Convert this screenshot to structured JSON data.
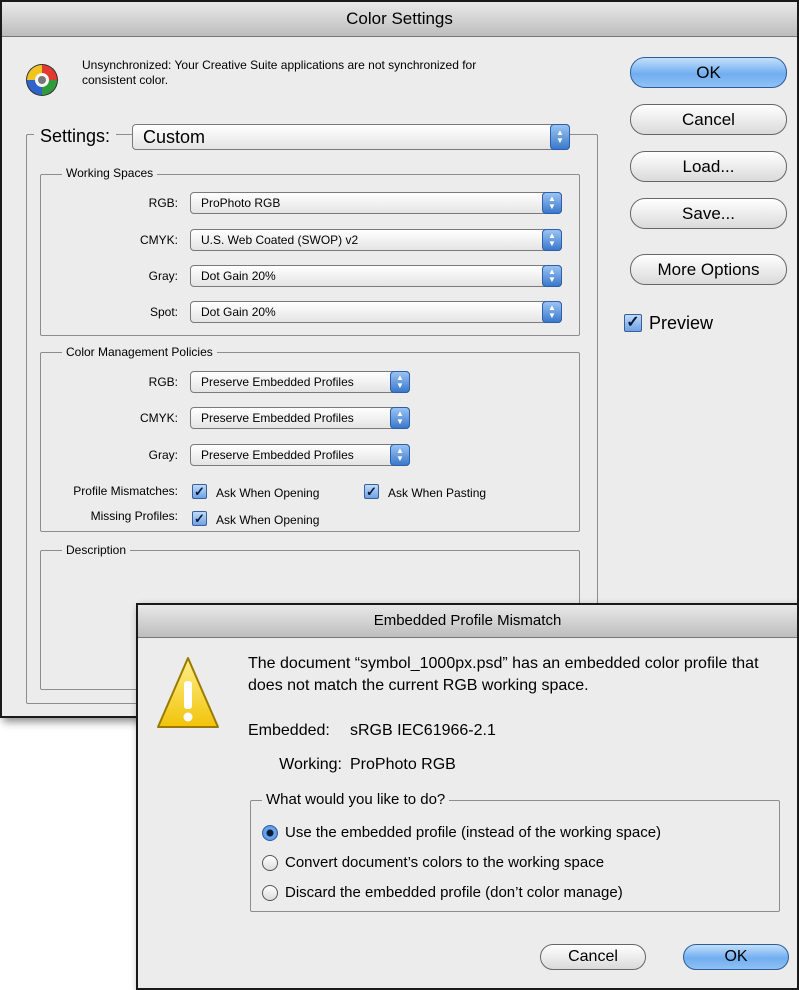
{
  "color_settings": {
    "title": "Color Settings",
    "sync_message": "Unsynchronized: Your Creative Suite applications are not synchronized for consistent color.",
    "settings_label": "Settings:",
    "settings_value": "Custom",
    "working_spaces": {
      "legend": "Working Spaces",
      "rgb_label": "RGB:",
      "rgb_value": "ProPhoto RGB",
      "cmyk_label": "CMYK:",
      "cmyk_value": "U.S. Web Coated (SWOP) v2",
      "gray_label": "Gray:",
      "gray_value": "Dot Gain 20%",
      "spot_label": "Spot:",
      "spot_value": "Dot Gain 20%"
    },
    "policies": {
      "legend": "Color Management Policies",
      "rgb_label": "RGB:",
      "rgb_value": "Preserve Embedded Profiles",
      "cmyk_label": "CMYK:",
      "cmyk_value": "Preserve Embedded Profiles",
      "gray_label": "Gray:",
      "gray_value": "Preserve Embedded Profiles",
      "profile_mismatches_label": "Profile Mismatches:",
      "ask_when_opening": "Ask When Opening",
      "ask_when_pasting": "Ask When Pasting",
      "missing_profiles_label": "Missing Profiles:",
      "missing_ask_when_opening": "Ask When Opening"
    },
    "description_legend": "Description",
    "buttons": {
      "ok": "OK",
      "cancel": "Cancel",
      "load": "Load...",
      "save": "Save...",
      "more_options": "More Options"
    },
    "preview_label": "Preview"
  },
  "mismatch_dialog": {
    "title": "Embedded Profile Mismatch",
    "message": "The document “symbol_1000px.psd” has an embedded color profile that does not match the current RGB working space.",
    "embedded_label": "Embedded:",
    "embedded_value": "sRGB IEC61966-2.1",
    "working_label": "Working:",
    "working_value": "ProPhoto RGB",
    "question": "What would you like to do?",
    "options": [
      "Use the embedded profile (instead of the working space)",
      "Convert document’s colors to the working space",
      "Discard the embedded profile (don’t color manage)"
    ],
    "selected_option": 0,
    "cancel": "Cancel",
    "ok": "OK"
  }
}
